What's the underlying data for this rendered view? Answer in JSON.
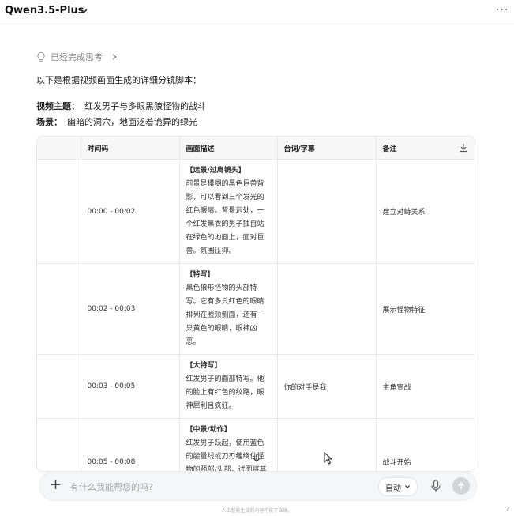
{
  "header": {
    "model_name": "Qwen3.5-Plus",
    "more_label": "···"
  },
  "thinking": {
    "label": "已经完成思考"
  },
  "intro": "以下是根据视频画面生成的详细分镜脚本：",
  "meta": [
    {
      "key": "视频主题：",
      "value": "红发男子与多眼黑狼怪物的战斗"
    },
    {
      "key": "场景：",
      "value": "幽暗的洞穴，地面泛着诡异的绿光"
    }
  ],
  "table": {
    "headers": [
      "",
      "时间码",
      "画面描述",
      "台词/字幕",
      "备注"
    ],
    "rows": [
      {
        "index": "",
        "time": "00:00 - 00:02",
        "shot": "【远景/过肩镜头】",
        "desc": "前景是模糊的黑色巨兽背影，可以看到三个发光的红色眼睛。背景远处，一个红发黑衣的男子独自站在绿色的地面上，面对巨兽。氛围压抑。",
        "dialogue": "",
        "note": "建立对峙关系"
      },
      {
        "index": "",
        "time": "00:02 - 00:03",
        "shot": "【特写】",
        "desc": "黑色狼形怪物的头部特写。它有多只红色的眼睛排列在脸颊侧面，还有一只黄色的眼睛，眼神凶恶。",
        "dialogue": "",
        "note": "展示怪物特征"
      },
      {
        "index": "",
        "time": "00:03 - 00:05",
        "shot": "【大特写】",
        "desc": "红发男子的面部特写。他的脸上有红色的纹路，眼神犀利且疯狂。",
        "dialogue": "你的对手是我",
        "note": "主角宣战"
      },
      {
        "index": "",
        "time": "00:05 - 00:08",
        "shot": "【中景/动作】",
        "desc": "红发男子跃起，使用蓝色的能量线或刀刃缠绕住怪物的颈部/头部，试图将其拉近，画面中能看到",
        "dialogue": "",
        "note": "战斗开始"
      }
    ]
  },
  "composer": {
    "placeholder": "有什么我能帮您的吗?",
    "mode_label": "自动"
  },
  "footer": {
    "disclaimer": "人工智能生成的内容可能不准确。",
    "help": "?"
  },
  "colors": {
    "send_button": "#d2d4d8",
    "table_header_bg": "#f7f7f8"
  }
}
